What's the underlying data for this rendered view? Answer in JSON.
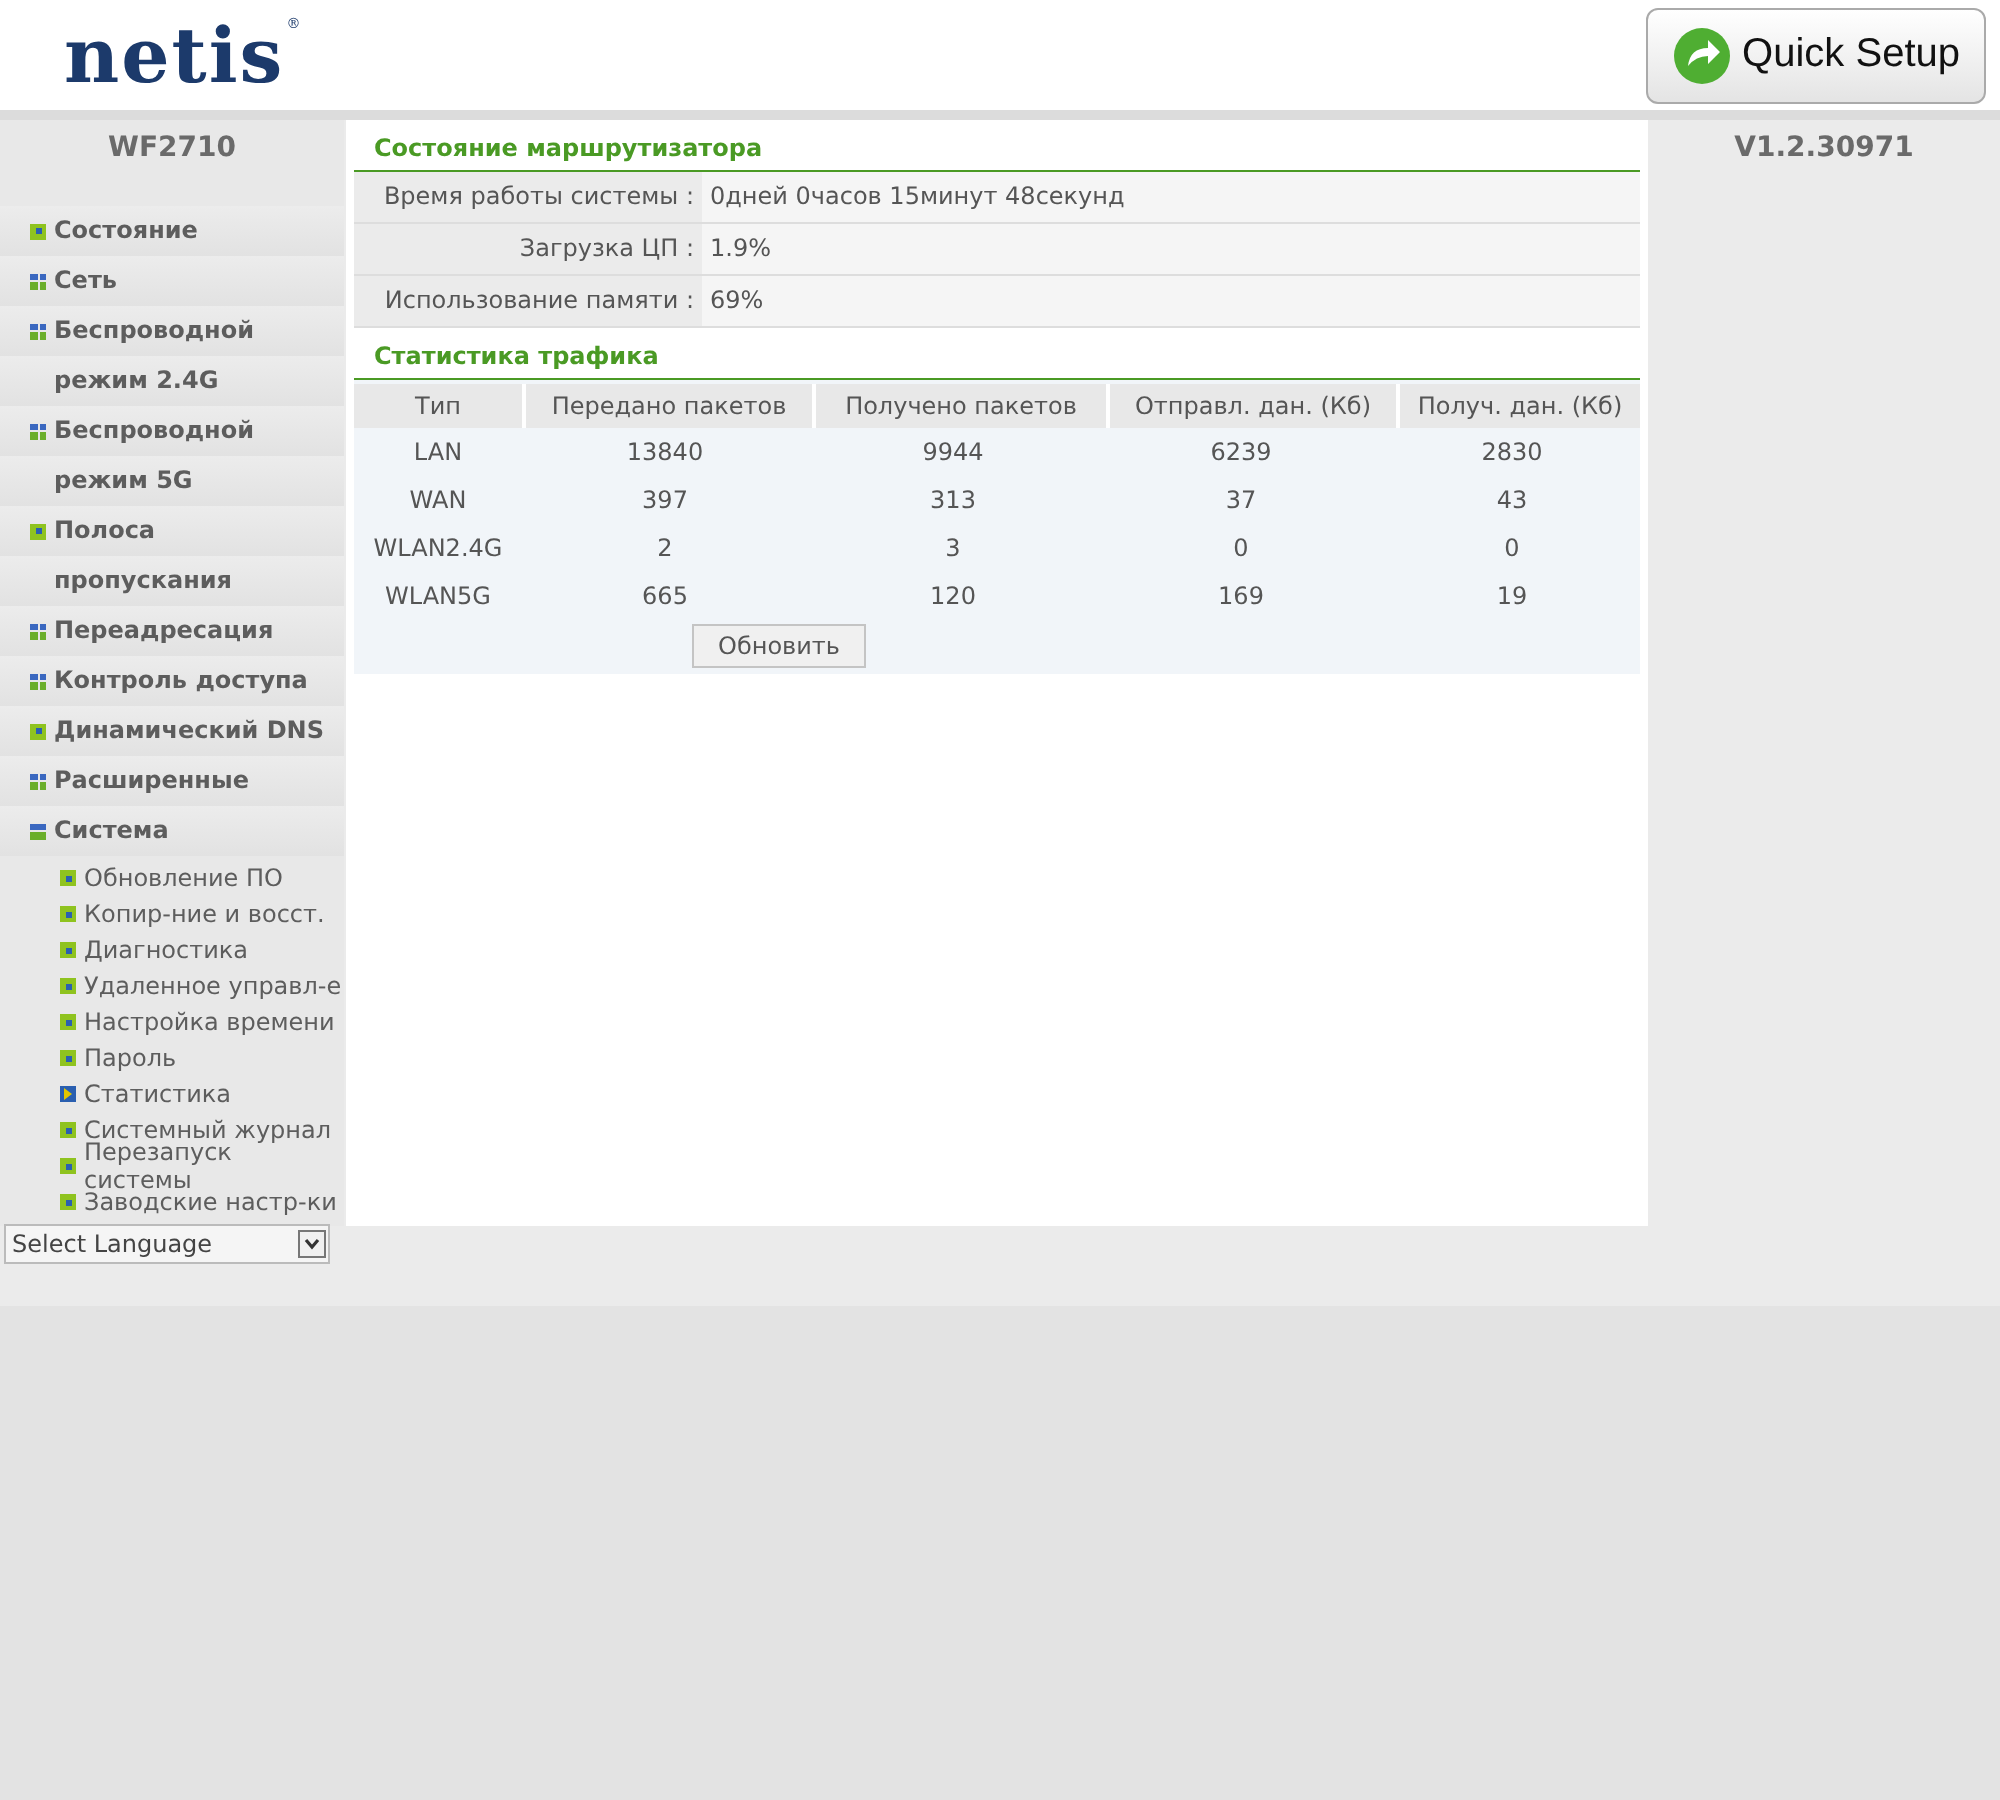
{
  "header": {
    "logo": "netis",
    "logo_mark": "®",
    "quick_setup": "Quick Setup"
  },
  "sidebar": {
    "model": "WF2710",
    "items": [
      {
        "label": "Состояние",
        "kind": "page"
      },
      {
        "label": "Сеть",
        "kind": "folder",
        "expanded": false
      },
      {
        "label": "Беспроводной режим 2.4G",
        "kind": "folder",
        "expanded": false
      },
      {
        "label": "Беспроводной режим 5G",
        "kind": "folder",
        "expanded": false
      },
      {
        "label": "Полоса пропускания",
        "kind": "page"
      },
      {
        "label": "Переадресация",
        "kind": "folder",
        "expanded": false
      },
      {
        "label": "Контроль доступа",
        "kind": "folder",
        "expanded": false
      },
      {
        "label": "Динамический DNS",
        "kind": "page"
      },
      {
        "label": "Расширенные",
        "kind": "folder",
        "expanded": false
      },
      {
        "label": "Система",
        "kind": "folder",
        "expanded": true,
        "children": [
          {
            "label": "Обновление ПО",
            "selected": false
          },
          {
            "label": "Копир-ние и восст.",
            "selected": false
          },
          {
            "label": "Диагностика",
            "selected": false
          },
          {
            "label": "Удаленное управл-е",
            "selected": false
          },
          {
            "label": "Настройка времени",
            "selected": false
          },
          {
            "label": "Пароль",
            "selected": false
          },
          {
            "label": "Статистика",
            "selected": true
          },
          {
            "label": "Системный журнал",
            "selected": false
          },
          {
            "label": "Перезапуск системы",
            "selected": false
          },
          {
            "label": "Заводские настр-ки",
            "selected": false
          }
        ]
      }
    ],
    "language": "Select Language"
  },
  "version": "V1.2.30971",
  "router_status": {
    "title": "Состояние маршрутизатора",
    "rows": [
      {
        "label": "Время работы системы :",
        "value": "0дней 0часов 15минут 48секунд"
      },
      {
        "label": "Загрузка ЦП :",
        "value": "1.9%"
      },
      {
        "label": "Использование памяти :",
        "value": "69%"
      }
    ]
  },
  "traffic": {
    "title": "Статистика трафика",
    "columns": [
      "Тип",
      "Передано пакетов",
      "Получено пакетов",
      "Отправл. дан. (Кб)",
      "Получ. дан. (Кб)"
    ],
    "rows": [
      [
        "LAN",
        "13840",
        "9944",
        "6239",
        "2830"
      ],
      [
        "WAN",
        "397",
        "313",
        "37",
        "43"
      ],
      [
        "WLAN2.4G",
        "2",
        "3",
        "0",
        "0"
      ],
      [
        "WLAN5G",
        "665",
        "120",
        "169",
        "19"
      ]
    ],
    "refresh": "Обновить"
  }
}
